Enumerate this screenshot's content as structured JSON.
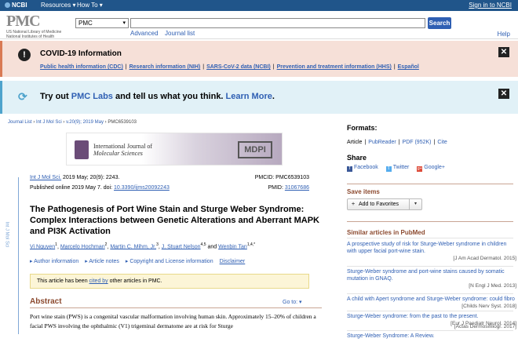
{
  "ncbi": {
    "logo": "NCBI",
    "resources": "Resources",
    "howto": "How To",
    "signin": "Sign in to NCBI"
  },
  "header": {
    "logo": "PMC",
    "sub1": "US National Library of Medicine",
    "sub2": "National Institutes of Health",
    "db_selected": "PMC",
    "search_label": "Search",
    "advanced": "Advanced",
    "journal_list": "Journal list",
    "help": "Help"
  },
  "covid": {
    "title": "COVID-19 Information",
    "links": [
      "Public health information (CDC)",
      "Research information (NIH)",
      "SARS-CoV-2 data (NCBI)",
      "Prevention and treatment information (HHS)",
      "Español"
    ]
  },
  "labs": {
    "pre": "Try out ",
    "link": "PMC Labs",
    "mid": " and tell us what you think. ",
    "learn": "Learn More",
    "post": "."
  },
  "breadcrumb": {
    "journal_list": "Journal List",
    "journal": "Int J Mol Sci",
    "issue": "v.20(9); 2019 May",
    "id": "PMC6539103",
    "sep": " › "
  },
  "banner": {
    "line1": "International Journal of",
    "line2": "Molecular Sciences",
    "publisher": "MDPI"
  },
  "sidebar_tab": "Int J Mol Sci",
  "meta": {
    "journal": "Int J Mol Sci.",
    "citation": " 2019 May; 20(9): 2243.",
    "published": "Published online 2019 May 7. doi: ",
    "doi": "10.3390/ijms20092243",
    "pmcid": "PMCID: PMC6539103",
    "pmid_label": "PMID: ",
    "pmid": "31067686"
  },
  "article": {
    "title": "The Pathogenesis of Port Wine Stain and Sturge Weber Syndrome: Complex Interactions between Genetic Alterations and Aberrant MAPK and PI3K Activation",
    "authors": [
      {
        "name": "Vi Nguyen",
        "sup": "1"
      },
      {
        "name": "Marcelo Hochman",
        "sup": "2"
      },
      {
        "name": "Martin C. Mihm, Jr.",
        "sup": "3"
      },
      {
        "name": "J. Stuart Nelson",
        "sup": "4,5"
      },
      {
        "name": "Wenbin Tan",
        "sup": "1,4,*"
      }
    ],
    "and": "and",
    "info_links": [
      "Author information",
      "Article notes",
      "Copyright and License information"
    ],
    "disclaimer": "Disclaimer",
    "cited_pre": "This article has been ",
    "cited_link": "cited by",
    "cited_post": " other articles in PMC.",
    "abstract_head": "Abstract",
    "goto": "Go to: ",
    "abstract_text": "Port wine stain (PWS) is a congenital vascular malformation involving human skin. Approximately 15–20% of children a facial PWS involving the ophthalmic (V1) trigeminal dermatome are at risk for Sturge"
  },
  "right": {
    "formats_title": "Formats:",
    "formats": [
      "Article",
      "PubReader",
      "PDF (952K)",
      "Cite"
    ],
    "share_title": "Share",
    "share": [
      "Facebook",
      "Twitter",
      "Google+"
    ],
    "save_title": "Save items",
    "add_fav": "Add to Favorites",
    "similar_title": "Similar articles in PubMed",
    "similar": [
      {
        "title": "A prospective study of risk for Sturge-Weber syndrome in children with upper facial port-wine stain.",
        "src": "[J Am Acad Dermatol. 2015]"
      },
      {
        "title": "Sturge-Weber syndrome and port-wine stains caused by somatic mutation in GNAQ.",
        "src": "[N Engl J Med. 2013]"
      },
      {
        "title": "A child with Apert syndrome and Sturge-Weber syndrome: could fibronectin or the RAS/MAPK signaling pa",
        "src": "[Childs Nerv Syst. 2018]"
      },
      {
        "title": "Sturge-Weber syndrome: from the past to the present.",
        "src": "[Eur J Paediatr Neurol. 2014]"
      },
      {
        "title": "Sturge-Weber Syndrome: A Review.",
        "src": "[Actas Dermosifiliogr. 2017]"
      }
    ]
  }
}
